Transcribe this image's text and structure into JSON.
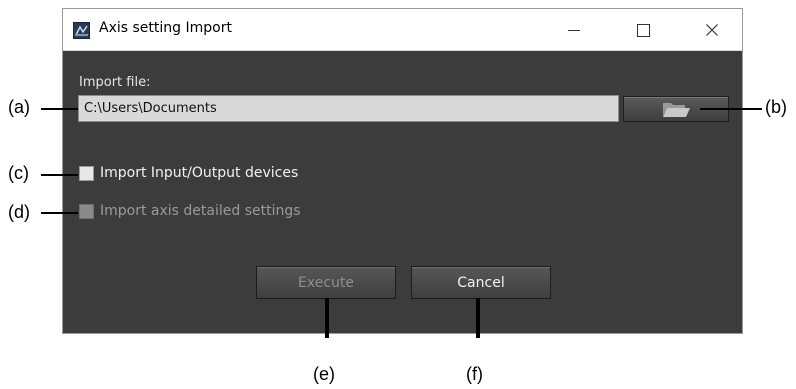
{
  "window": {
    "title": "Axis setting Import",
    "icon": "axis-app-icon",
    "controls": {
      "minimize": "minimize-icon",
      "maximize": "maximize-icon",
      "close": "close-icon"
    }
  },
  "form": {
    "import_label": "Import file:",
    "import_path": "C:\\Users\\Documents",
    "browse_icon": "folder-open-icon",
    "checkbox_io": {
      "label": "Import Input/Output devices",
      "checked": false,
      "enabled": true
    },
    "checkbox_axis": {
      "label": "Import axis detailed settings",
      "checked": false,
      "enabled": false
    },
    "execute_label": "Execute",
    "cancel_label": "Cancel"
  },
  "callouts": {
    "a": "(a)",
    "b": "(b)",
    "c": "(c)",
    "d": "(d)",
    "e": "(e)",
    "f": "(f)"
  },
  "colors": {
    "dialog_bg": "#3c3c3c",
    "titlebar_bg": "#ffffff",
    "input_bg": "#d9d9d9",
    "button_bg": "#4a4a4a",
    "text_light": "#f2f2f2",
    "text_disabled": "#8f8f8f"
  }
}
